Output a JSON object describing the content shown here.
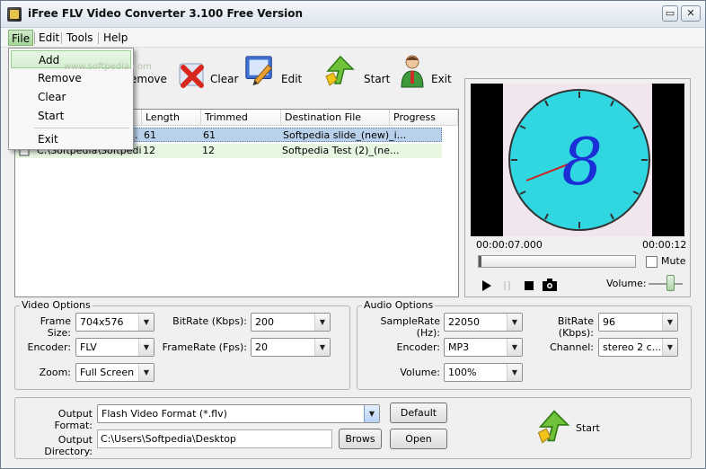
{
  "window": {
    "title": "iFree FLV Video Converter 3.100  Free Version",
    "min_glyph": "▭",
    "close_glyph": "✕"
  },
  "menu": {
    "file": "File",
    "edit": "Edit",
    "tools": "Tools",
    "help": "Help"
  },
  "file_menu": {
    "add": "Add",
    "remove": "Remove",
    "clear": "Clear",
    "start": "Start",
    "exit": "Exit",
    "watermark": "www.softpedia.com"
  },
  "toolbar": {
    "remove_partial": "emove",
    "clear": "Clear",
    "edit": "Edit",
    "start": "Start",
    "exit": "Exit"
  },
  "filelist": {
    "columns": {
      "length": "Length",
      "trimmed_length": "Trimmed Length",
      "destination": "Destination File",
      "progress": "Progress"
    },
    "rows": [
      {
        "name": "",
        "length": "61",
        "trimmed": "61",
        "destination": "Softpedia slide_(new)_i..."
      },
      {
        "name": "C:\\Softpedia\\Softpedi...",
        "length": "12",
        "trimmed": "12",
        "destination": "Softpedia Test (2)_(ne..."
      }
    ],
    "partial_dot": "."
  },
  "preview": {
    "time_current": "00:00:07.000",
    "time_total": "00:00:12",
    "mute": "Mute",
    "volume": "Volume:",
    "clock_digit": "8"
  },
  "video_options": {
    "title": "Video Options",
    "frame_size_label": "Frame Size:",
    "frame_size": "704x576",
    "encoder_label": "Encoder:",
    "encoder": "FLV",
    "zoom_label": "Zoom:",
    "zoom": "Full Screen",
    "bitrate_label": "BitRate (Kbps):",
    "bitrate": "200",
    "framerate_label": "FrameRate (Fps):",
    "framerate": "20"
  },
  "audio_options": {
    "title": "Audio Options",
    "samplerate_label": "SampleRate (Hz):",
    "samplerate": "22050",
    "encoder_label": "Encoder:",
    "encoder": "MP3",
    "volume_label": "Volume:",
    "volume": "100%",
    "bitrate_label": "BitRate (Kbps):",
    "bitrate": "96",
    "channel_label": "Channel:",
    "channel": "stereo 2 c..."
  },
  "output": {
    "format_label": "Output Format:",
    "format": "Flash Video Format (*.flv)",
    "directory_label": "Output Directory:",
    "directory": "C:\\Users\\Softpedia\\Desktop",
    "default_btn": "Default",
    "browse_btn": "Brows",
    "open_btn": "Open",
    "start": "Start"
  },
  "colors": {
    "clock_face": "#31d7e0",
    "clock_digit": "#1a2fd6",
    "hand": "#cc2222",
    "menu_active": "#a6d59b"
  },
  "icons": {
    "remove": "delete-x-icon",
    "edit": "edit-pencil-icon",
    "start": "start-arrow-icon",
    "exit": "user-exit-icon",
    "file": "file-icon"
  }
}
